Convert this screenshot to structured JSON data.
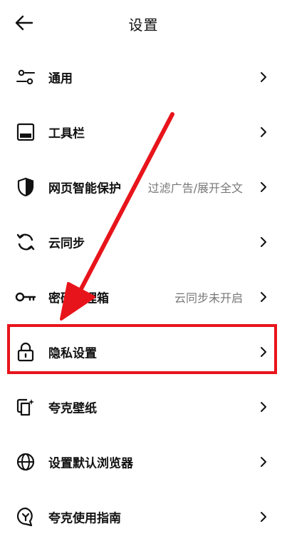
{
  "header": {
    "title": "设置",
    "back_icon": "arrow-left-icon"
  },
  "settings": [
    {
      "id": "general",
      "icon": "sliders-icon",
      "label": "通用",
      "value": ""
    },
    {
      "id": "toolbar",
      "icon": "toolbar-icon",
      "label": "工具栏",
      "value": ""
    },
    {
      "id": "web-protection",
      "icon": "shield-icon",
      "label": "网页智能保护",
      "value": "过滤广告/展开全文"
    },
    {
      "id": "cloud-sync",
      "icon": "sync-icon",
      "label": "云同步",
      "value": ""
    },
    {
      "id": "password-manager",
      "icon": "key-icon",
      "label": "密码管理箱",
      "value": "云同步未开启"
    },
    {
      "id": "privacy",
      "icon": "lock-icon",
      "label": "隐私设置",
      "value": ""
    },
    {
      "id": "wallpaper",
      "icon": "wallpaper-icon",
      "label": "夸克壁纸",
      "value": ""
    },
    {
      "id": "default-browser",
      "icon": "globe-icon",
      "label": "设置默认浏览器",
      "value": ""
    },
    {
      "id": "guide",
      "icon": "guide-icon",
      "label": "夸克使用指南",
      "value": ""
    }
  ],
  "annotation": {
    "highlight_color": "#e8141b",
    "highlighted_item": "隐私设置"
  }
}
